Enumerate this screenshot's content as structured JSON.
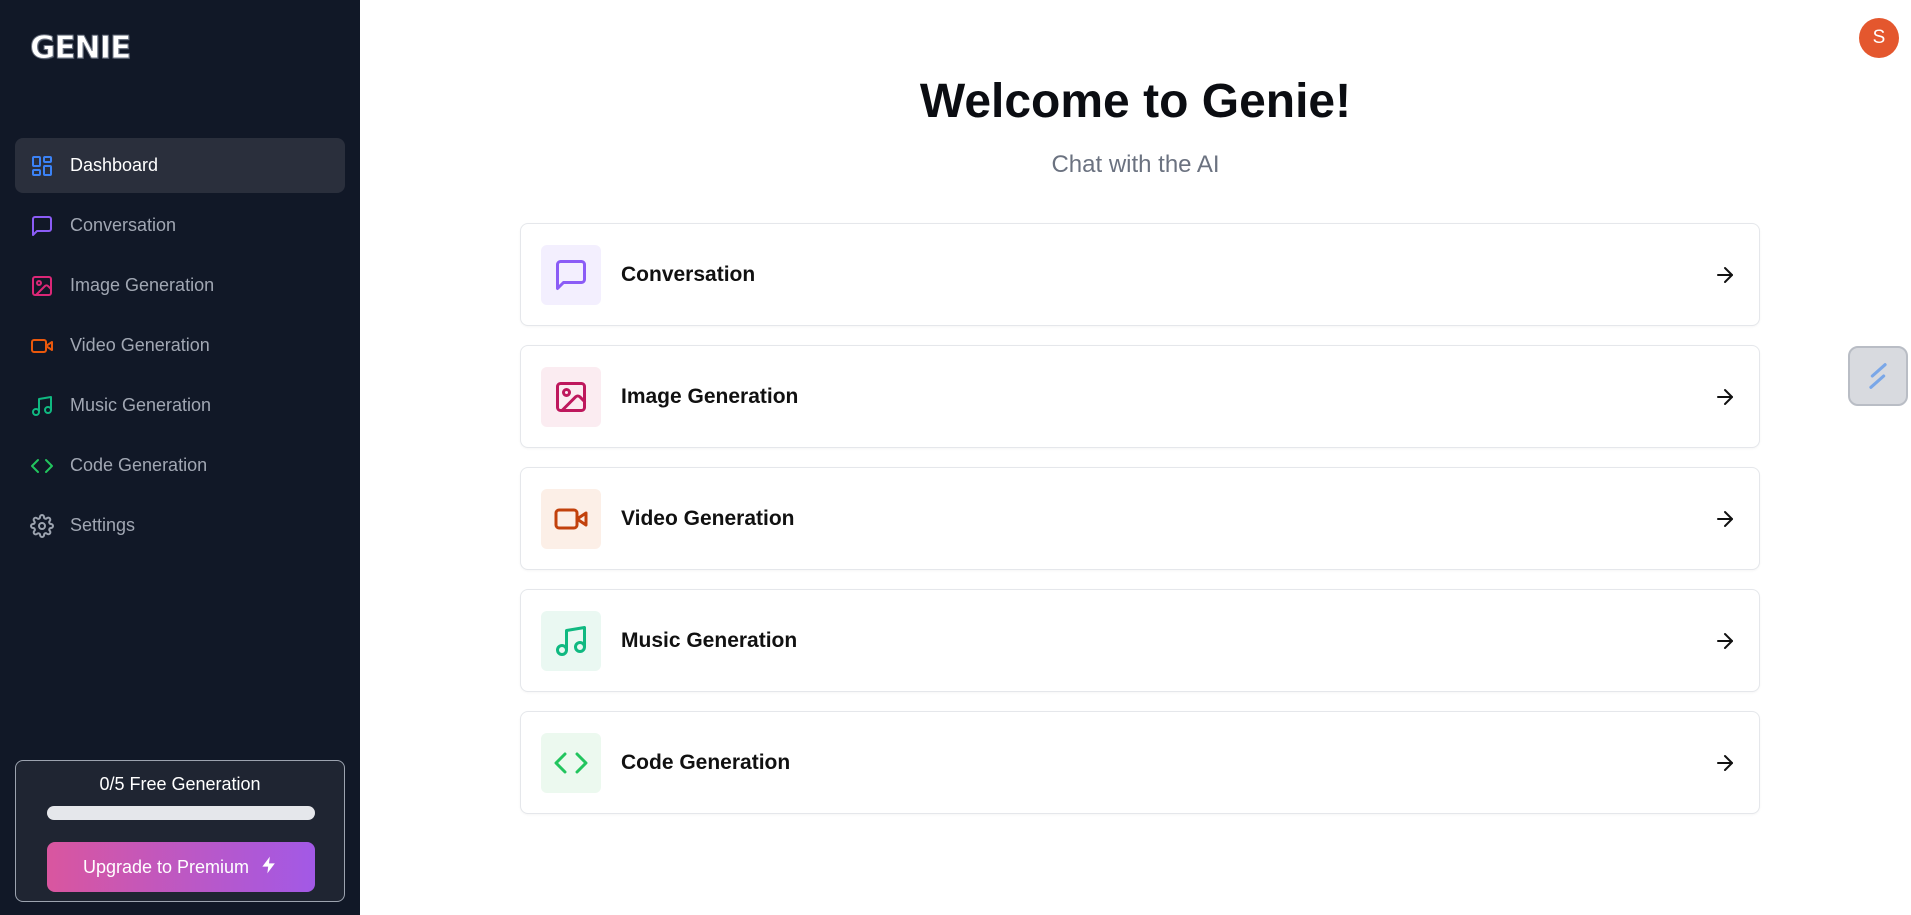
{
  "brand": {
    "logo_text": "GENIE"
  },
  "sidebar": {
    "items": [
      {
        "label": "Dashboard",
        "icon": "layout-dashboard-icon",
        "color": "#3b82f6",
        "active": true
      },
      {
        "label": "Conversation",
        "icon": "message-square-icon",
        "color": "#8b5cf6",
        "active": false
      },
      {
        "label": "Image Generation",
        "icon": "image-icon",
        "color": "#db2777",
        "active": false
      },
      {
        "label": "Video Generation",
        "icon": "video-icon",
        "color": "#ea580c",
        "active": false
      },
      {
        "label": "Music Generation",
        "icon": "music-icon",
        "color": "#10b981",
        "active": false
      },
      {
        "label": "Code Generation",
        "icon": "code-icon",
        "color": "#22c55e",
        "active": false
      },
      {
        "label": "Settings",
        "icon": "settings-icon",
        "color": "#9ca3af",
        "active": false
      }
    ],
    "quota": {
      "text": "0/5 Free Generation",
      "used": 0,
      "limit": 5
    },
    "upgrade_label": "Upgrade to Premium"
  },
  "header": {
    "avatar_initial": "S"
  },
  "main": {
    "title": "Welcome to Genie!",
    "subtitle": "Chat with the AI",
    "tools": [
      {
        "label": "Conversation",
        "icon": "message-square-icon",
        "color": "#8b5cf6",
        "bg": "#f3effe"
      },
      {
        "label": "Image Generation",
        "icon": "image-icon",
        "color": "#be185d",
        "bg": "#fbecf1"
      },
      {
        "label": "Video Generation",
        "icon": "video-icon",
        "color": "#c2410c",
        "bg": "#fcefe7"
      },
      {
        "label": "Music Generation",
        "icon": "music-icon",
        "color": "#10b981",
        "bg": "#eaf8f2"
      },
      {
        "label": "Code Generation",
        "icon": "code-icon",
        "color": "#22c55e",
        "bg": "#ecf9ef"
      }
    ]
  },
  "colors": {
    "sidebar_bg": "#111827",
    "accent_gradient_start": "#d9569f",
    "accent_gradient_end": "#a259e6",
    "avatar_bg": "#e4572e"
  }
}
